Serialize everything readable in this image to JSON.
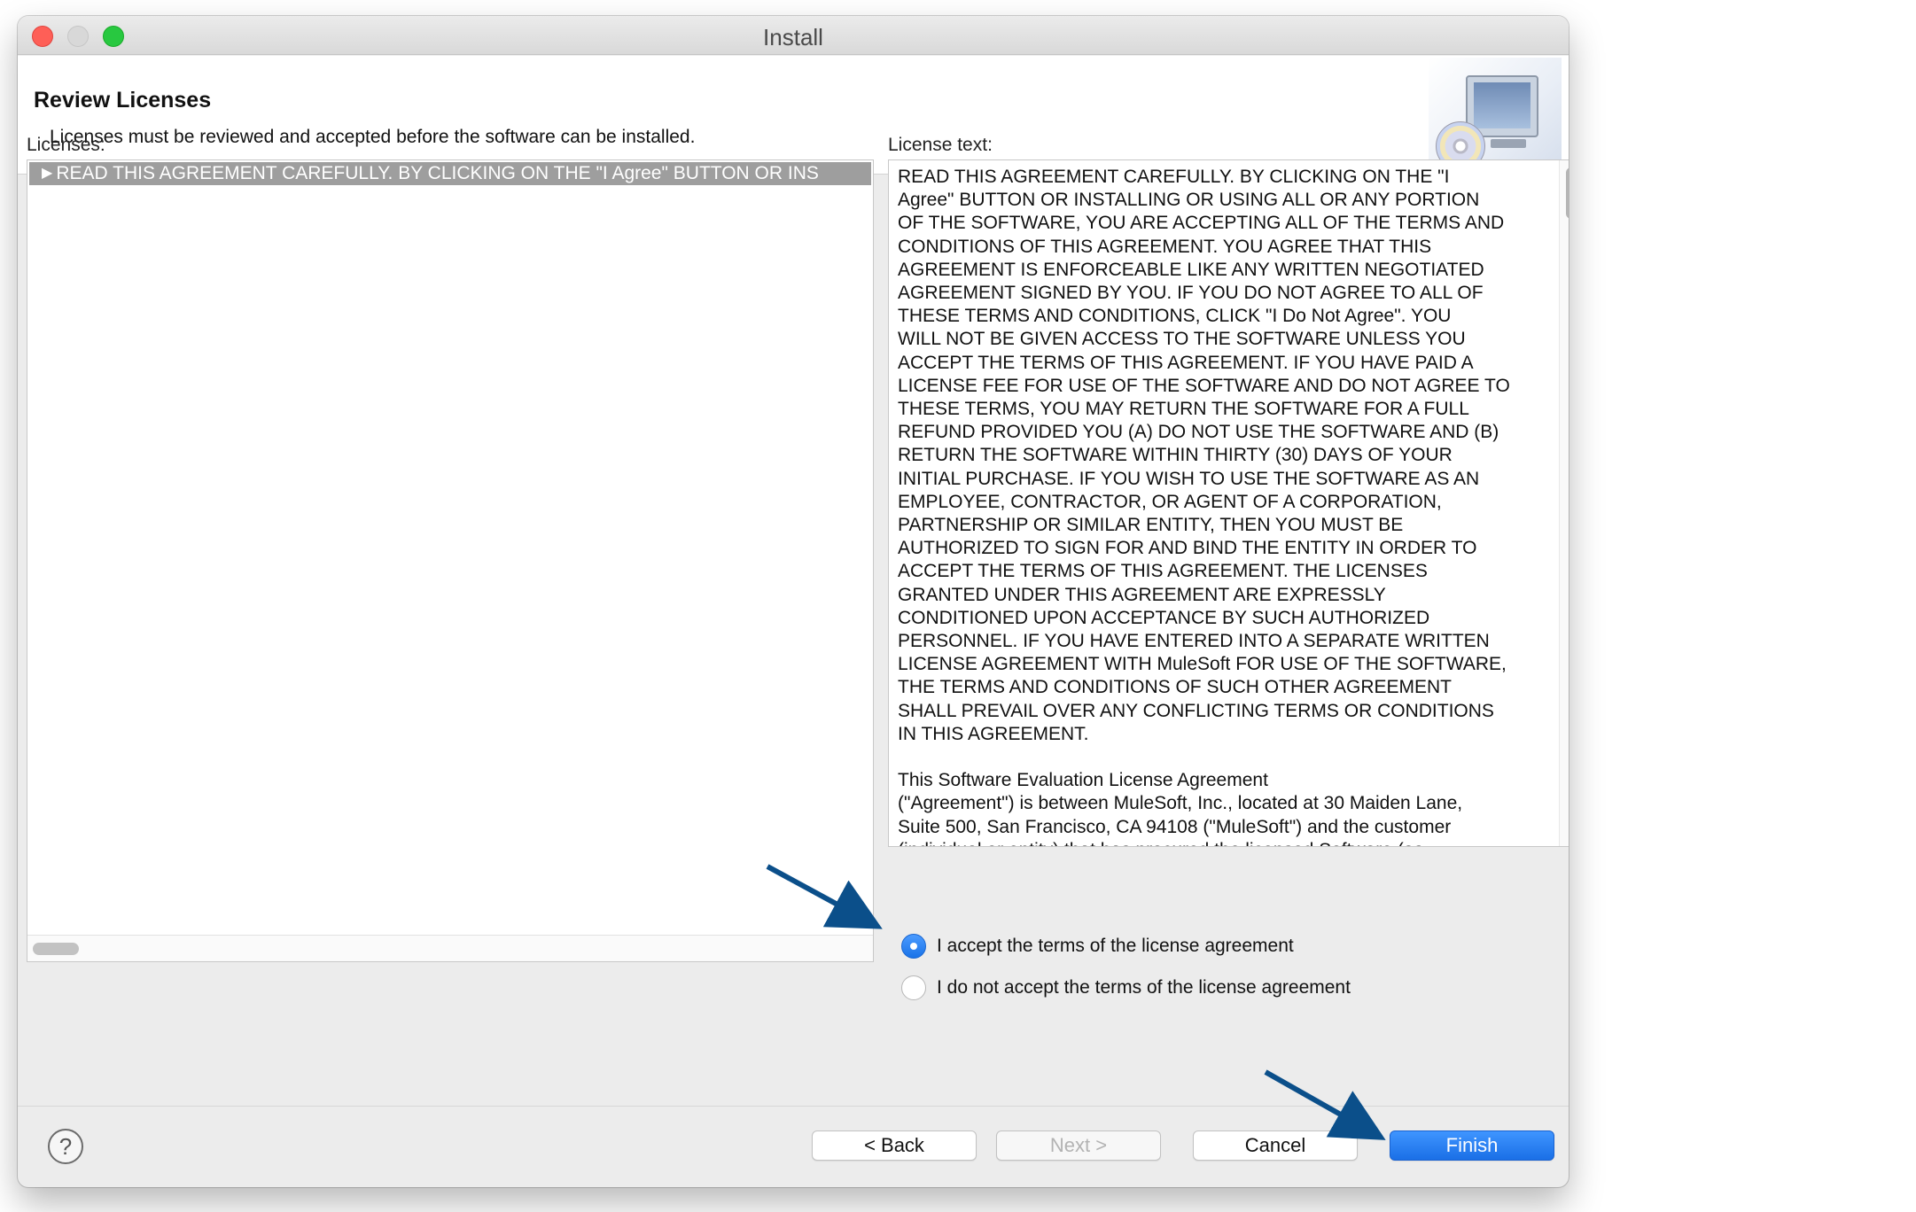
{
  "window": {
    "title": "Install"
  },
  "header": {
    "title": "Review Licenses",
    "description": "Licenses must be reviewed and accepted before the software can be installed."
  },
  "licenses": {
    "label": "Licenses:",
    "items": [
      {
        "label": "READ THIS AGREEMENT CAREFULLY. BY CLICKING ON THE \"I Agree\" BUTTON OR INS"
      }
    ]
  },
  "license_text": {
    "label": "License text:",
    "body": "READ THIS AGREEMENT CAREFULLY. BY CLICKING ON THE \"I\nAgree\" BUTTON OR INSTALLING OR USING ALL OR ANY PORTION\nOF THE SOFTWARE, YOU ARE ACCEPTING ALL OF THE TERMS AND\nCONDITIONS OF THIS AGREEMENT. YOU AGREE THAT THIS\nAGREEMENT IS ENFORCEABLE LIKE ANY WRITTEN NEGOTIATED\nAGREEMENT SIGNED BY YOU. IF YOU DO NOT AGREE TO ALL OF\nTHESE TERMS AND CONDITIONS, CLICK \"I Do Not Agree\". YOU\nWILL NOT BE GIVEN ACCESS TO THE SOFTWARE UNLESS YOU\nACCEPT THE TERMS OF THIS AGREEMENT. IF YOU HAVE PAID A\nLICENSE FEE FOR USE OF THE SOFTWARE AND DO NOT AGREE TO\nTHESE TERMS, YOU MAY RETURN THE SOFTWARE FOR A FULL\nREFUND PROVIDED YOU (A) DO NOT USE THE SOFTWARE AND (B)\nRETURN THE SOFTWARE WITHIN THIRTY (30) DAYS OF YOUR\nINITIAL PURCHASE. IF YOU WISH TO USE THE SOFTWARE AS AN\nEMPLOYEE, CONTRACTOR, OR AGENT OF A CORPORATION,\nPARTNERSHIP OR SIMILAR ENTITY, THEN YOU MUST BE\nAUTHORIZED TO SIGN FOR AND BIND THE ENTITY IN ORDER TO\nACCEPT THE TERMS OF THIS AGREEMENT. THE LICENSES\nGRANTED UNDER THIS AGREEMENT ARE EXPRESSLY\nCONDITIONED UPON ACCEPTANCE BY SUCH AUTHORIZED\nPERSONNEL. IF YOU HAVE ENTERED INTO A SEPARATE WRITTEN\nLICENSE AGREEMENT WITH MuleSoft FOR USE OF THE SOFTWARE,\nTHE TERMS AND CONDITIONS OF SUCH OTHER AGREEMENT\nSHALL PREVAIL OVER ANY CONFLICTING TERMS OR CONDITIONS\nIN THIS AGREEMENT.\n\n            This Software Evaluation License Agreement\n(\"Agreement\") is between MuleSoft, Inc., located at 30 Maiden Lane,\nSuite 500, San Francisco, CA 94108 (\"MuleSoft\") and the customer\n(individual or entity) that has procured the licensed Software (as"
  },
  "options": {
    "accept": "I accept the terms of the license agreement",
    "decline": "I do not accept the terms of the license agreement",
    "selected": "accept"
  },
  "buttons": {
    "help": "?",
    "back": "< Back",
    "next": "Next >",
    "cancel": "Cancel",
    "finish": "Finish"
  },
  "colors": {
    "accent": "#1a73e8",
    "annotation_arrow": "#0b4f8a",
    "selection": "#9e9e9e"
  },
  "icons": {
    "header": "install-monitor-cd-icon",
    "tree_toggle": "triangle-right-icon"
  }
}
